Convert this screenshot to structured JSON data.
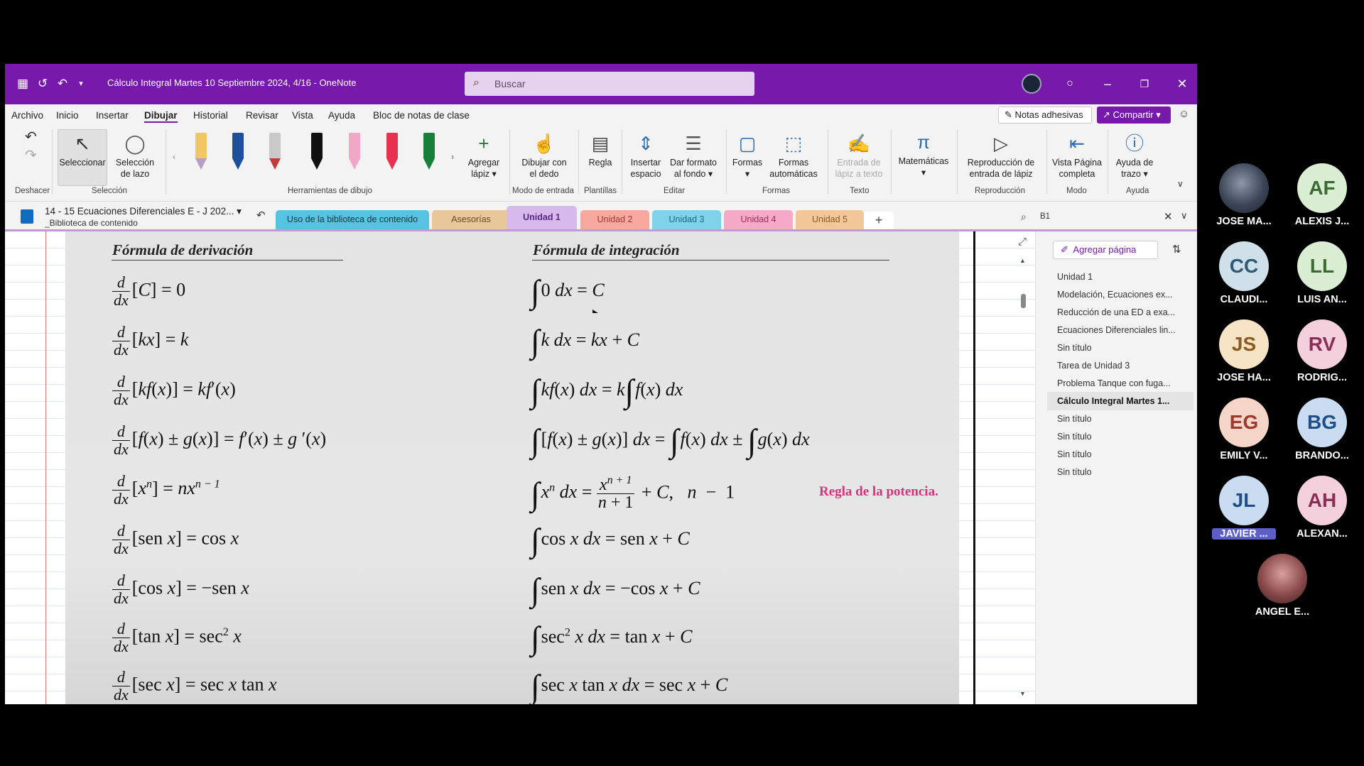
{
  "window": {
    "title": "Cálculo Integral Martes 10 Septiembre 2024, 4/16  -  OneNote",
    "search_placeholder": "Buscar"
  },
  "menu": [
    "Archivo",
    "Inicio",
    "Insertar",
    "Dibujar",
    "Historial",
    "Revisar",
    "Vista",
    "Ayuda",
    "Bloc de notas de clase"
  ],
  "menu_active": "Dibujar",
  "header_buttons": {
    "sticky_notes": "Notas adhesivas",
    "share": "Compartir"
  },
  "ribbon": {
    "selection": {
      "select": "Seleccionar",
      "lasso_1": "Selección",
      "lasso_2": "de lazo"
    },
    "add_pen_1": "Agregar",
    "add_pen_2": "lápiz",
    "finger_1": "Dibujar con",
    "finger_2": "el dedo",
    "ruler": "Regla",
    "insert_space_1": "Insertar",
    "insert_space_2": "espacio",
    "background_1": "Dar formato",
    "background_2": "al fondo",
    "shapes": "Formas",
    "auto_shapes_1": "Formas",
    "auto_shapes_2": "automáticas",
    "ink_text_1": "Entrada de",
    "ink_text_2": "lápiz a texto",
    "math": "Matemáticas",
    "replay_1": "Reproducción de",
    "replay_2": "entrada de lápiz",
    "fullpage_1": "Vista Página",
    "fullpage_2": "completa",
    "stroke_help_1": "Ayuda de",
    "stroke_help_2": "trazo",
    "groups": {
      "undo": "Deshacer",
      "selection": "Selección",
      "tools": "Herramientas de dibujo",
      "input": "Modo de entrada",
      "templates": "Plantillas",
      "edit": "Editar",
      "shapes": "Formas",
      "text": "Texto",
      "replay": "Reproducción",
      "mode": "Modo",
      "help": "Ayuda"
    },
    "pen_colors": [
      "#f1c766",
      "#1e4f9a",
      "#c23b3b",
      "#111111",
      "#f3a7c8",
      "#e8304f",
      "#16803b"
    ]
  },
  "notebook": {
    "name": "14 - 15 Ecuaciones Diferenciales E - J 202...",
    "section_group": "_Biblioteca de contenido"
  },
  "section_tabs": [
    {
      "label": "Uso de la biblioteca de contenido",
      "color": "#56c3e0"
    },
    {
      "label": "Asesorías",
      "color": "#e8c79b"
    },
    {
      "label": "Unidad 1",
      "color": "#d8b9ee"
    },
    {
      "label": "Unidad 2",
      "color": "#f7a9a0"
    },
    {
      "label": "Unidad 3",
      "color": "#7ed3e8"
    },
    {
      "label": "Unidad 4",
      "color": "#f7a9c8"
    },
    {
      "label": "Unidad 5",
      "color": "#f2c89a"
    }
  ],
  "find": {
    "query": "B1"
  },
  "formulas": {
    "deriv_header": "Fórmula de derivación",
    "integ_header": "Fórmula de integración",
    "power_rule_note": "Regla de la potencia."
  },
  "pages": {
    "add_page": "Agregar página",
    "items": [
      "Unidad 1",
      "Modelación, Ecuaciones ex...",
      "Reducción de una ED a exa...",
      "Ecuaciones Diferenciales lin...",
      "Sin título",
      "Tarea de Unidad 3",
      "Problema Tanque con fuga...",
      "Cálculo Integral Martes 1...",
      "Sin título",
      "Sin título",
      "Sin título",
      "Sin título"
    ],
    "selected_index": 7
  },
  "participants": [
    {
      "initials": "",
      "name": "JOSE MA...",
      "color": "#4a5568",
      "photo": true
    },
    {
      "initials": "AF",
      "name": "ALEXIS J...",
      "color": "#d9eed3"
    },
    {
      "initials": "CC",
      "name": "CLAUDI...",
      "color": "#cfe0ea"
    },
    {
      "initials": "LL",
      "name": "LUIS AN...",
      "color": "#d9eed3"
    },
    {
      "initials": "JS",
      "name": "JOSE HA...",
      "color": "#f7e3c5"
    },
    {
      "initials": "RV",
      "name": "RODRIG...",
      "color": "#f3d0dc"
    },
    {
      "initials": "EG",
      "name": "EMILY V...",
      "color": "#f4d5c8"
    },
    {
      "initials": "BG",
      "name": "BRANDO...",
      "color": "#c9dcf2"
    },
    {
      "initials": "JL",
      "name": "JAVIER ...",
      "color": "#c9dcf2",
      "highlight": true
    },
    {
      "initials": "AH",
      "name": "ALEXAN...",
      "color": "#f3d0dc"
    },
    {
      "initials": "",
      "name": "ANGEL E...",
      "color": "#8a4a4a",
      "photo": true
    }
  ]
}
